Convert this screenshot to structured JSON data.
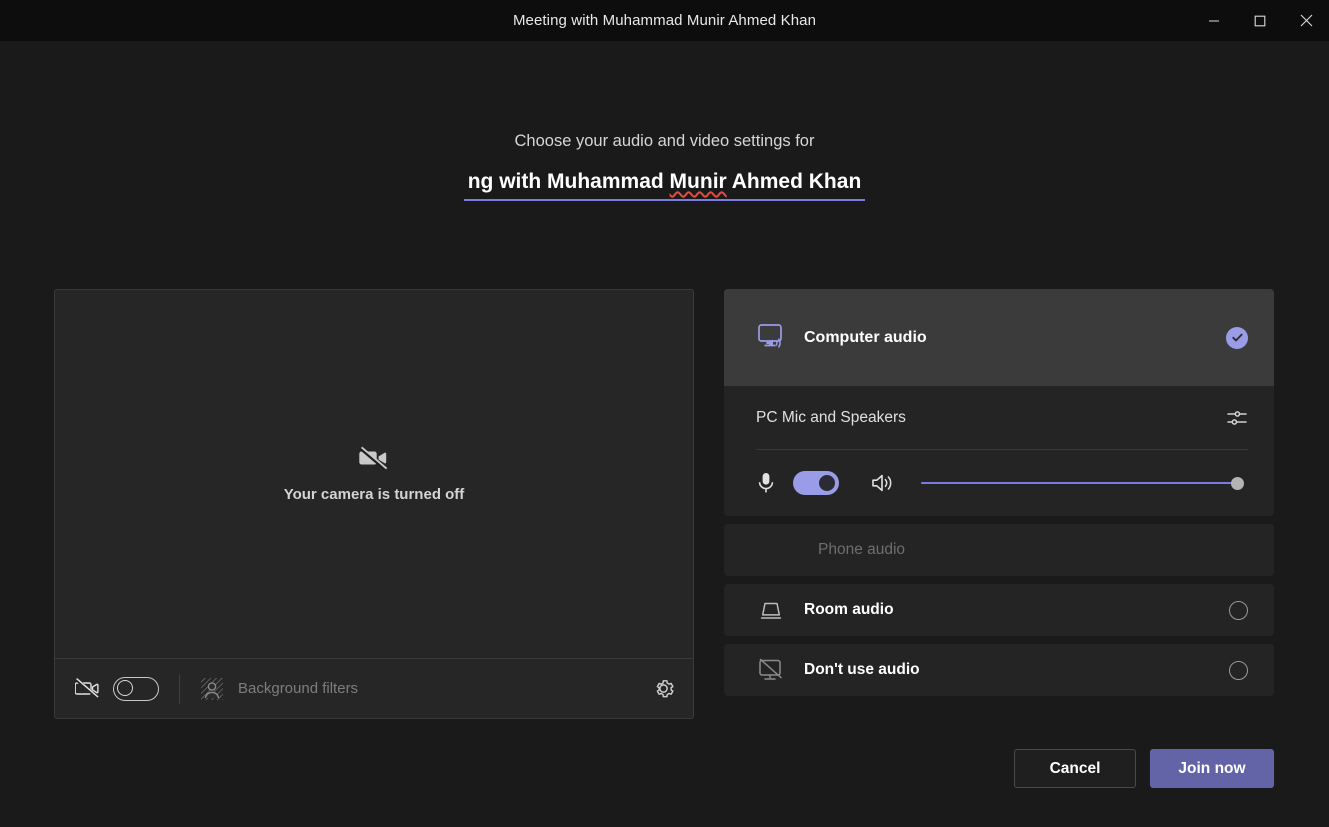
{
  "window": {
    "title": "Meeting with Muhammad Munir Ahmed Khan",
    "controls": {
      "minimize": "minimize-icon",
      "maximize": "maximize-icon",
      "close": "close-icon"
    }
  },
  "header": {
    "subheading": "Choose your audio and video settings for",
    "meeting_title_visible": "ng with Muhammad Munir Ahmed Khan",
    "meeting_title_parts": {
      "before": "ng with Muhammad ",
      "misspelled": "Munir",
      "after": " Ahmed Khan"
    }
  },
  "video": {
    "camera_off_message": "Your camera is turned off",
    "camera_off_icon": "video-off-icon",
    "toolbar": {
      "camera_toggle_icon": "video-off-icon",
      "camera_toggle_state": "off",
      "background_filters_label": "Background filters",
      "background_filters_icon": "background-blur-icon",
      "background_filters_enabled": false,
      "settings_icon": "gear-icon"
    }
  },
  "audio": {
    "options": [
      {
        "id": "computer-audio",
        "label": "Computer audio",
        "icon": "computer-audio-icon",
        "selected": true,
        "indicator": "checkmark-filled"
      },
      {
        "id": "phone-audio",
        "label": "Phone audio",
        "icon": null,
        "selected": false,
        "disabled": true,
        "indicator": "none"
      },
      {
        "id": "room-audio",
        "label": "Room audio",
        "icon": "room-speaker-icon",
        "selected": false,
        "indicator": "radio-empty"
      },
      {
        "id": "dont-use-audio",
        "label": "Don't use audio",
        "icon": "no-audio-icon",
        "selected": false,
        "indicator": "radio-empty"
      }
    ],
    "device": {
      "name": "PC Mic and Speakers",
      "settings_icon": "sliders-icon",
      "mic_icon": "microphone-icon",
      "mic_toggle_state": "on",
      "speaker_icon": "speaker-icon",
      "volume_percent": 100
    }
  },
  "actions": {
    "cancel_label": "Cancel",
    "join_label": "Join now"
  },
  "colors": {
    "accent_purple": "#6264a7",
    "accent_light": "#9b9ce8",
    "slider_purple": "#7b7ce0",
    "page_background": "#1a1a1a",
    "titlebar_background": "#0d0d0d",
    "card_background": "#242424",
    "selected_row_background": "#3b3b3b",
    "spellcheck_red": "#e04a3f"
  }
}
